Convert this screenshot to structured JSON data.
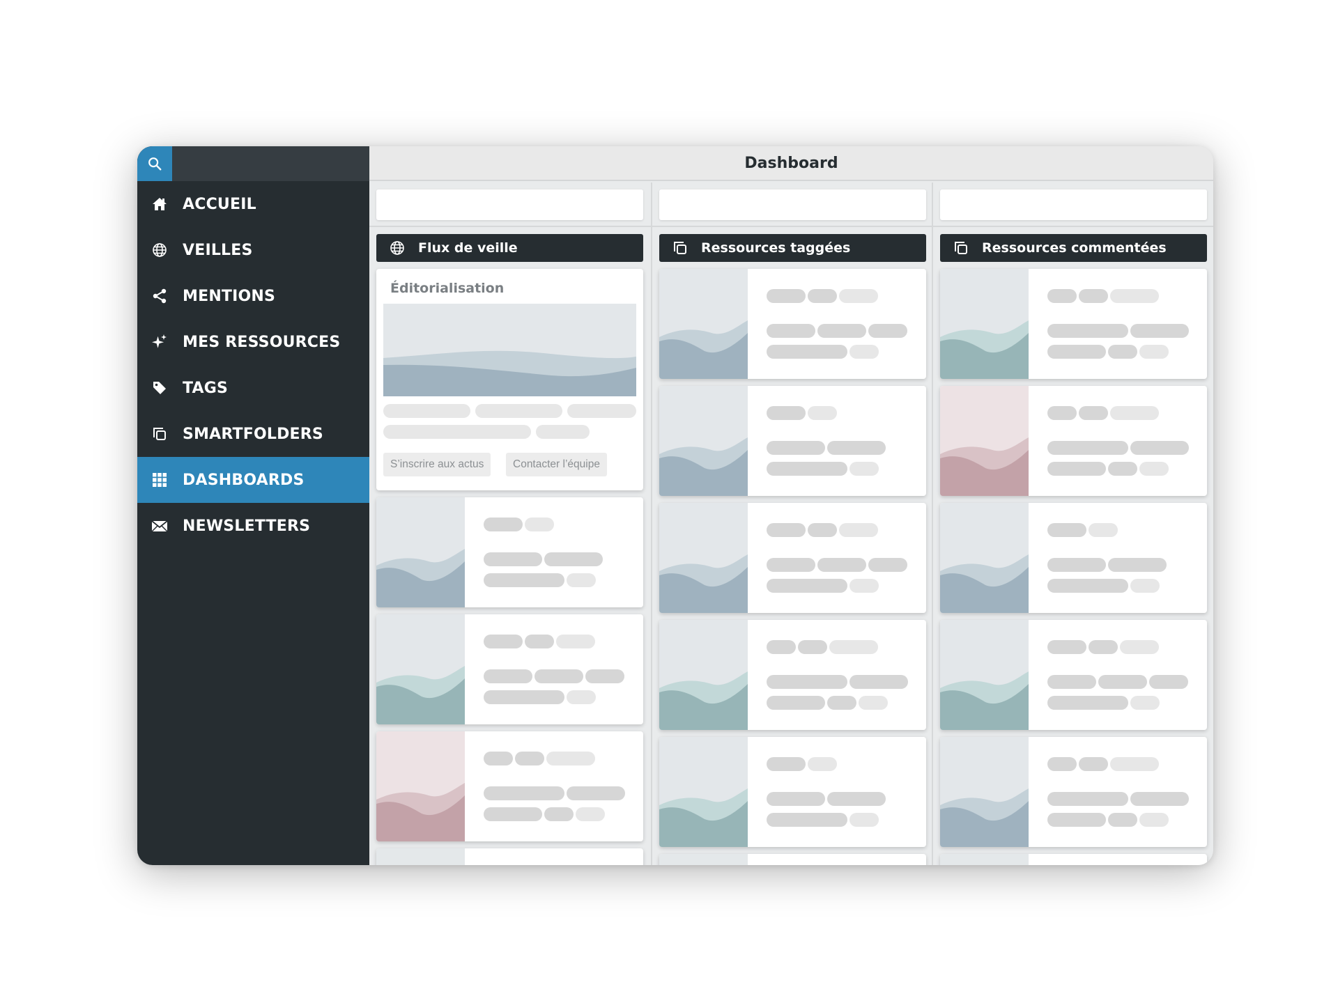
{
  "sidebar": {
    "items": [
      {
        "label": "ACCUEIL",
        "icon": "home-icon",
        "active": false
      },
      {
        "label": "VEILLES",
        "icon": "globe-icon",
        "active": false
      },
      {
        "label": "MENTIONS",
        "icon": "share-icon",
        "active": false
      },
      {
        "label": "MES RESSOURCES",
        "icon": "sparkle-icon",
        "active": false
      },
      {
        "label": "TAGS",
        "icon": "tag-icon",
        "active": false
      },
      {
        "label": "SMARTFOLDERS",
        "icon": "copy-icon",
        "active": false
      },
      {
        "label": "DASHBOARDS",
        "icon": "grid-icon",
        "active": true
      },
      {
        "label": "NEWSLETTERS",
        "icon": "envelope-icon",
        "active": false
      }
    ]
  },
  "header": {
    "title": "Dashboard"
  },
  "columns": [
    {
      "title": "Flux de veille",
      "icon": "globe-icon"
    },
    {
      "title": "Ressources taggées",
      "icon": "copy-icon"
    },
    {
      "title": "Ressources commentées",
      "icon": "copy-icon"
    }
  ],
  "featured": {
    "title": "Éditorialisation",
    "subscribe_label": "S’inscrire aux actus",
    "contact_label": "Contacter l’équipe"
  },
  "colors": {
    "sidebar_bg": "#262d31",
    "accent": "#2e86b9",
    "thumb_blue": "#9fb2bf",
    "thumb_teal": "#97b5b7",
    "thumb_rose": "#c3a2a8"
  }
}
